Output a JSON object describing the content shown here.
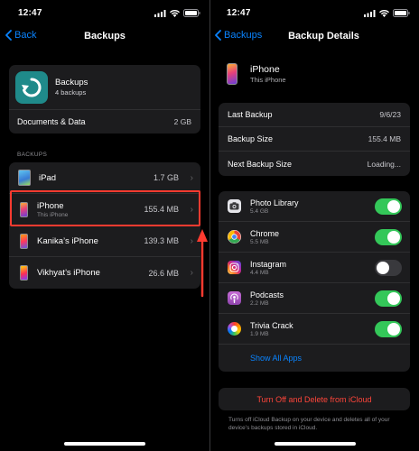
{
  "left": {
    "status": {
      "time": "12:47"
    },
    "nav": {
      "back": "Back",
      "title": "Backups"
    },
    "summary": {
      "title": "Backups",
      "subtitle": "4 backups",
      "docs_label": "Documents & Data",
      "docs_value": "2 GB"
    },
    "section_header": "BACKUPS",
    "devices": [
      {
        "name": "iPad",
        "sub": "",
        "size": "1.7 GB"
      },
      {
        "name": "iPhone",
        "sub": "This iPhone",
        "size": "155.4 MB"
      },
      {
        "name": "Kanika’s iPhone",
        "sub": "",
        "size": "139.3 MB"
      },
      {
        "name": "Vikhyat’s iPhone",
        "sub": "",
        "size": "26.6 MB"
      }
    ],
    "highlight_color": "#ff3b30"
  },
  "right": {
    "status": {
      "time": "12:47"
    },
    "nav": {
      "back": "Backups",
      "title": "Backup Details"
    },
    "device": {
      "name": "iPhone",
      "sub": "This iPhone"
    },
    "info": [
      {
        "label": "Last Backup",
        "value": "9/6/23"
      },
      {
        "label": "Backup Size",
        "value": "155.4 MB"
      },
      {
        "label": "Next Backup Size",
        "value": "Loading..."
      }
    ],
    "apps": [
      {
        "name": "Photo Library",
        "size": "5.4 GB",
        "on": true,
        "icon": "photo-library-icon"
      },
      {
        "name": "Chrome",
        "size": "5.5 MB",
        "on": true,
        "icon": "chrome-icon"
      },
      {
        "name": "Instagram",
        "size": "4.4 MB",
        "on": false,
        "icon": "instagram-icon"
      },
      {
        "name": "Podcasts",
        "size": "2.2 MB",
        "on": true,
        "icon": "podcasts-icon"
      },
      {
        "name": "Trivia Crack",
        "size": "1.9 MB",
        "on": true,
        "icon": "trivia-crack-icon"
      }
    ],
    "show_all": "Show All Apps",
    "delete_button": "Turn Off and Delete from iCloud",
    "footer": "Turns off iCloud Backup on your device and deletes all of your device’s backups stored in iCloud.",
    "accent": "#0a84ff",
    "destructive": "#ff453a",
    "toggle_on_color": "#34c759"
  }
}
